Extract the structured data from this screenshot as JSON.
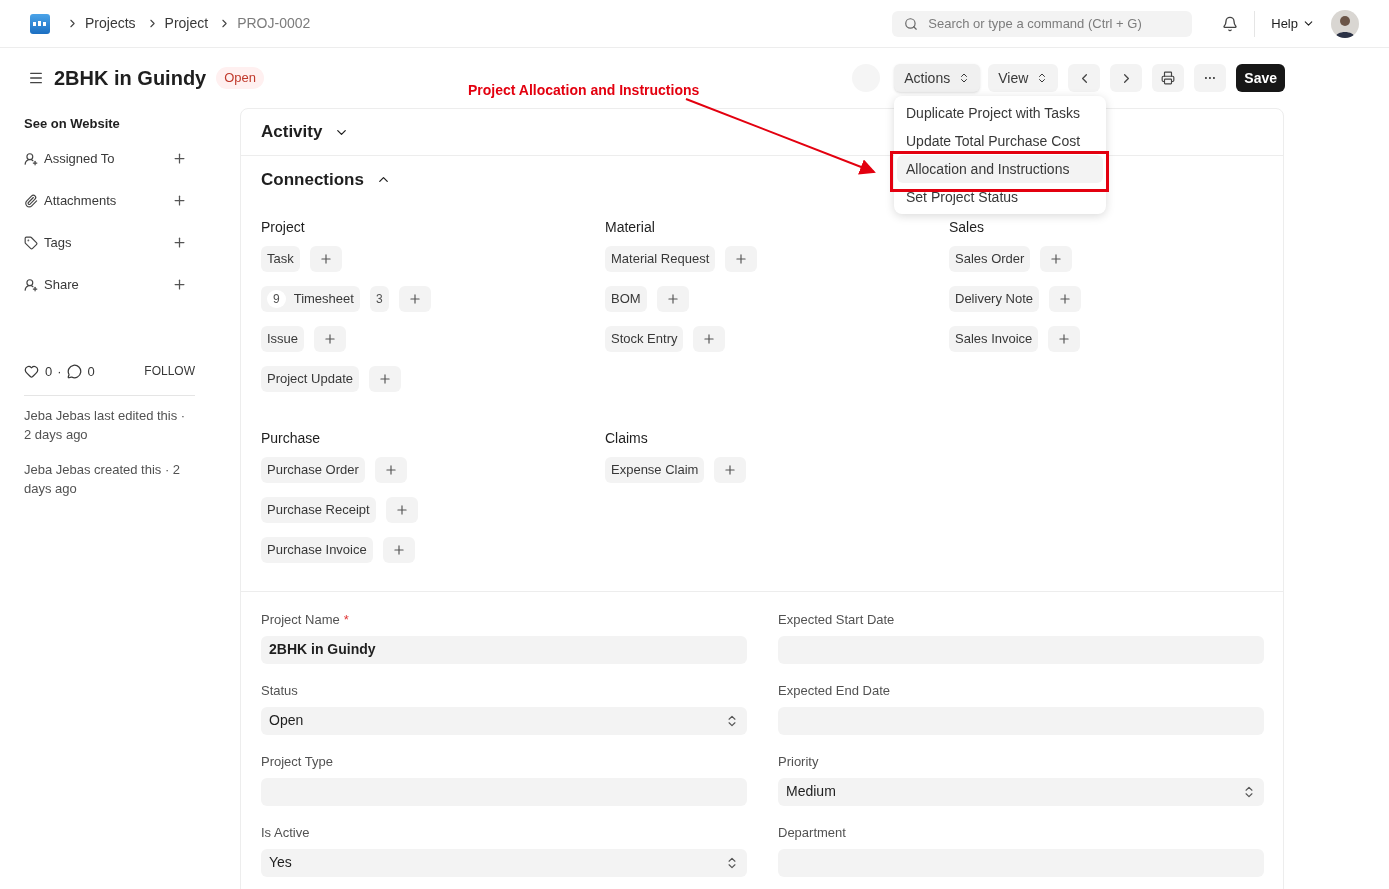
{
  "breadcrumbs": [
    {
      "label": "Projects",
      "current": false
    },
    {
      "label": "Project",
      "current": false
    },
    {
      "label": "PROJ-0002",
      "current": true
    }
  ],
  "search": {
    "placeholder": "Search or type a command (Ctrl + G)"
  },
  "help": "Help",
  "title": "2BHK in Guindy",
  "status_badge": "Open",
  "toolbar": {
    "actions": "Actions",
    "view": "View",
    "save": "Save",
    "more": "···"
  },
  "actions_menu": [
    {
      "label": "Duplicate Project with Tasks",
      "selected": false
    },
    {
      "label": "Update Total Purchase Cost",
      "selected": false
    },
    {
      "label": "Allocation and Instructions",
      "selected": true
    },
    {
      "label": "Set Project Status",
      "selected": false
    }
  ],
  "annotation": {
    "text": "Project Allocation and Instructions"
  },
  "sidebar": {
    "website_link": "See on Website",
    "items": [
      {
        "label": "Assigned To",
        "kind": "user"
      },
      {
        "label": "Attachments",
        "kind": "clip"
      },
      {
        "label": "Tags",
        "kind": "tag"
      },
      {
        "label": "Share",
        "kind": "user"
      }
    ],
    "likes": "0",
    "separator": "·",
    "comments": "0",
    "follow": "FOLLOW",
    "activity": [
      "Jeba Jebas last edited this · 2 days ago",
      "Jeba Jebas created this · 2 days ago"
    ]
  },
  "sections": [
    {
      "title": "Activity",
      "expanded": false
    },
    {
      "title": "Connections",
      "expanded": true
    }
  ],
  "connections": [
    {
      "group": "Project",
      "items": [
        {
          "label": "Task"
        },
        {
          "label": "Timesheet",
          "count": "9",
          "open_count": "3"
        },
        {
          "label": "Issue"
        },
        {
          "label": "Project Update"
        }
      ]
    },
    {
      "group": "Material",
      "items": [
        {
          "label": "Material Request"
        },
        {
          "label": "BOM"
        },
        {
          "label": "Stock Entry"
        }
      ]
    },
    {
      "group": "Sales",
      "items": [
        {
          "label": "Sales Order"
        },
        {
          "label": "Delivery Note"
        },
        {
          "label": "Sales Invoice"
        }
      ]
    },
    {
      "group": "Purchase",
      "items": [
        {
          "label": "Purchase Order"
        },
        {
          "label": "Purchase Receipt"
        },
        {
          "label": "Purchase Invoice"
        }
      ]
    },
    {
      "group": "Claims",
      "items": [
        {
          "label": "Expense Claim"
        }
      ]
    }
  ],
  "required_mark": "*",
  "form": [
    {
      "label": "Project Name",
      "required": true,
      "kind": "input",
      "value": "2BHK in Guindy"
    },
    {
      "label": "Expected Start Date",
      "required": false,
      "kind": "input"
    },
    {
      "label": "Status",
      "required": false,
      "kind": "select",
      "value": "Open"
    },
    {
      "label": "Expected End Date",
      "required": false,
      "kind": "input"
    },
    {
      "label": "Project Type",
      "required": false,
      "kind": "input"
    },
    {
      "label": "Priority",
      "required": false,
      "kind": "select",
      "value": "Medium"
    },
    {
      "label": "Is Active",
      "required": false,
      "kind": "select",
      "value": "Yes"
    },
    {
      "label": "Department",
      "required": false,
      "kind": "input"
    }
  ]
}
